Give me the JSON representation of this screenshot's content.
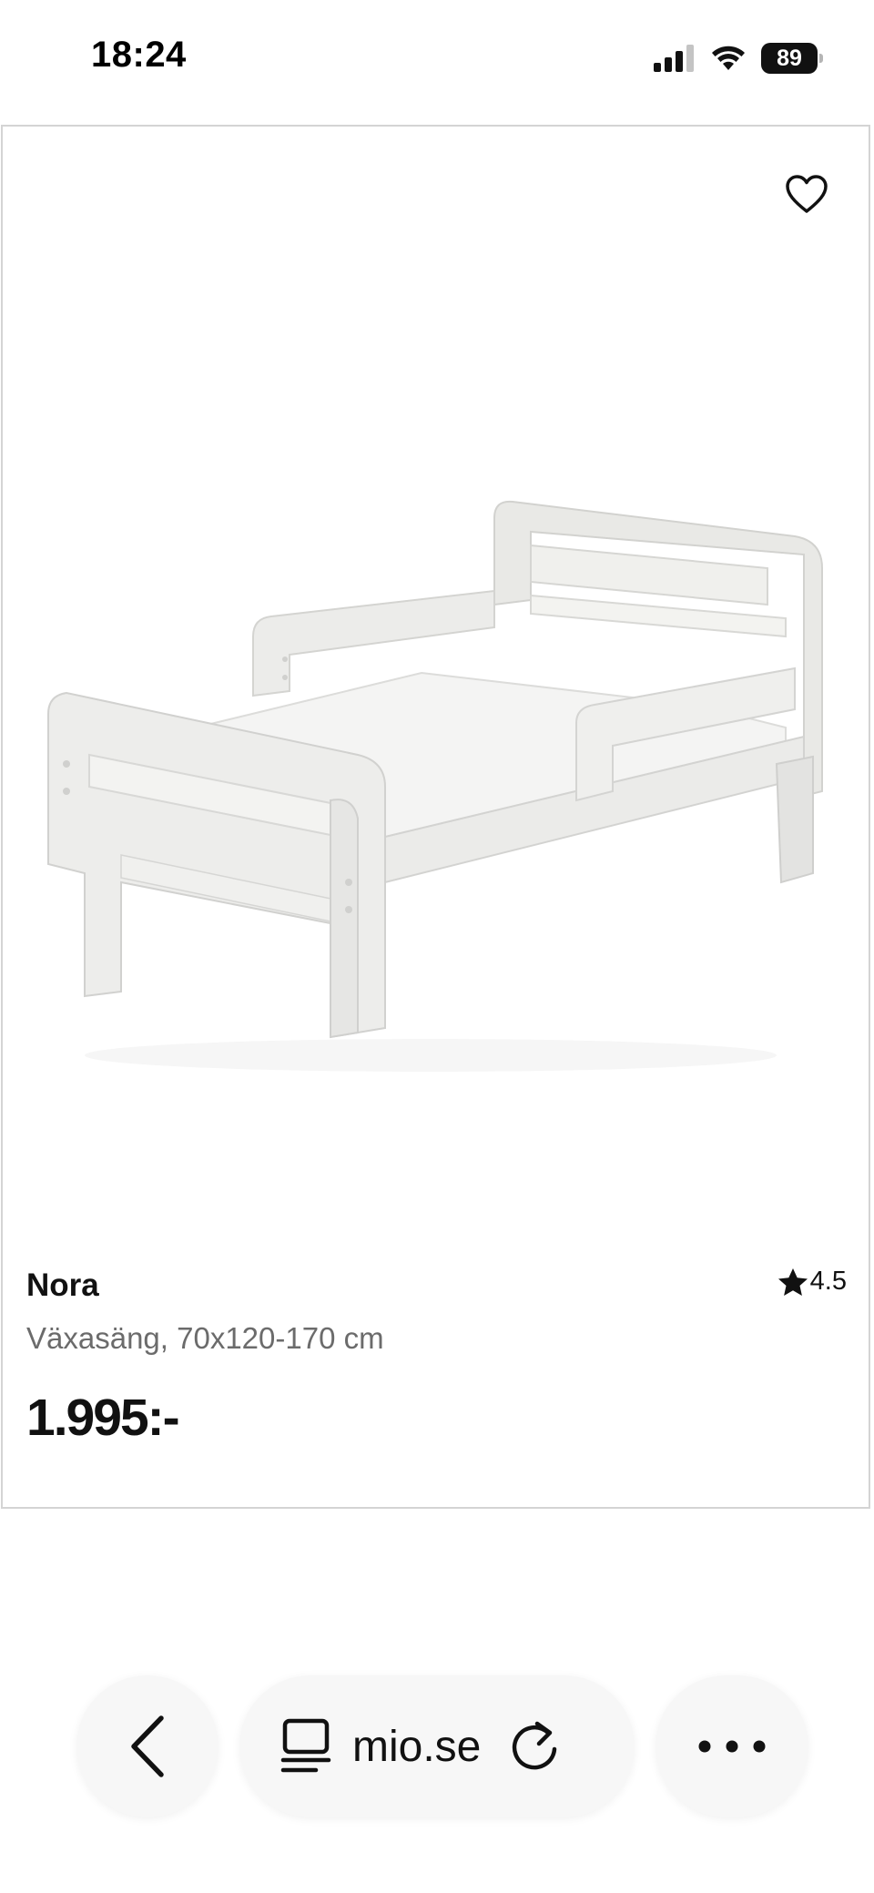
{
  "status_bar": {
    "time": "18:24",
    "battery_level": "89",
    "icons": [
      "cellular-signal-icon",
      "wifi-icon",
      "battery-icon"
    ]
  },
  "product": {
    "name": "Nora",
    "description": "Växasäng, 70x120-170 cm",
    "price": "1.995:-",
    "rating": "4.5",
    "image_alt": "White toddler bed",
    "favorite_icon": "heart-outline-icon",
    "rating_icon": "star-icon"
  },
  "browser_toolbar": {
    "url": "mio.se",
    "back_icon": "chevron-left-icon",
    "page_menu_icon": "page-menu-icon",
    "reload_icon": "reload-icon",
    "more_icon": "more-dots-icon"
  },
  "colors": {
    "card_border": "#d4d4d4",
    "secondary_text": "#6b6b6b",
    "toolbar_pill": "#f7f7f7"
  }
}
